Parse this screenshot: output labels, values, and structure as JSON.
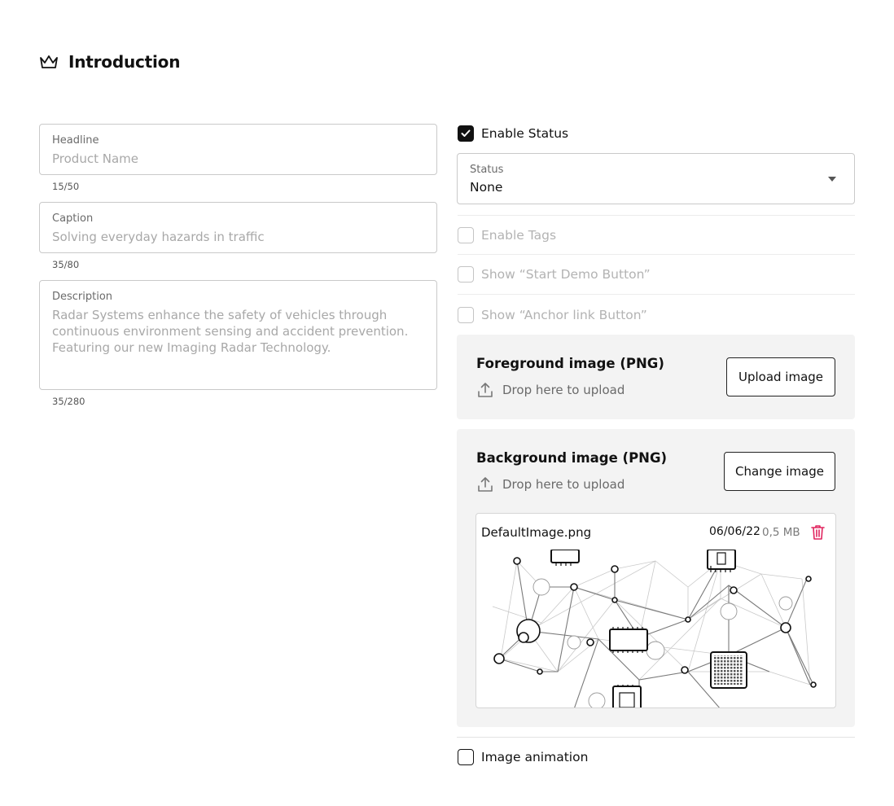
{
  "section": {
    "title": "Introduction",
    "icon": "crown-icon"
  },
  "fields": {
    "headline": {
      "label": "Headline",
      "placeholder": "Product Name",
      "counter": "15/50"
    },
    "caption": {
      "label": "Caption",
      "placeholder": "Solving everyday hazards in traffic",
      "counter": "35/80"
    },
    "description": {
      "label": "Description",
      "placeholder": "Radar Systems enhance the safety of vehicles through continuous environment sensing and accident prevention. Featuring our new Imaging Radar Technology.",
      "counter": "35/280"
    }
  },
  "options": {
    "enable_status": {
      "label": "Enable Status",
      "checked": true
    },
    "status_select": {
      "label": "Status",
      "value": "None"
    },
    "enable_tags": {
      "label": "Enable Tags",
      "checked": false,
      "disabled": true
    },
    "show_start_demo": {
      "label": "Show “Start Demo Button”",
      "checked": false,
      "disabled": true
    },
    "show_anchor_link": {
      "label": "Show “Anchor link Button”",
      "checked": false,
      "disabled": true
    },
    "image_animation": {
      "label": "Image animation",
      "checked": false
    }
  },
  "foreground_image": {
    "title": "Foreground image (PNG)",
    "drop_text": "Drop here to upload",
    "button_label": "Upload image"
  },
  "background_image": {
    "title": "Background image (PNG)",
    "drop_text": "Drop here to upload",
    "button_label": "Change image",
    "file": {
      "name": "DefaultImage.png",
      "date": "06/06/22",
      "size": "0,5 MB",
      "preview": "network-circuit-illustration"
    }
  },
  "colors": {
    "delete_icon": "#e0245e",
    "checked_box": "#111111",
    "card_background": "#f3f3f3"
  }
}
